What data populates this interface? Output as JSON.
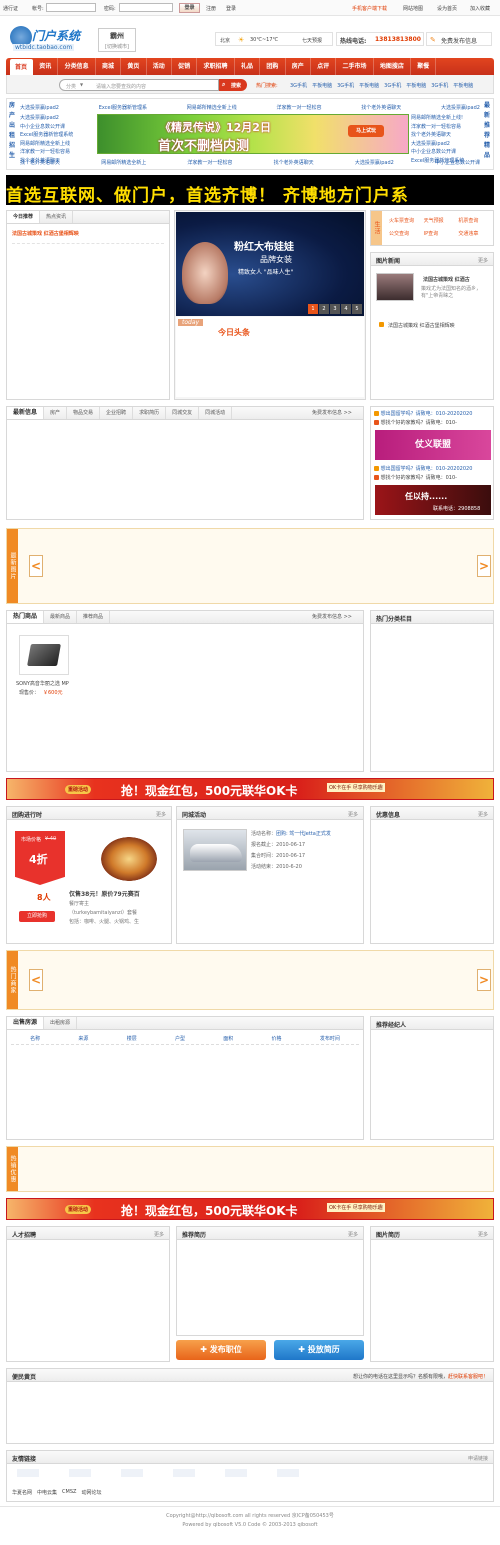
{
  "topbar": {
    "passport": "通行证",
    "account": "帐号:",
    "password": "密码:",
    "login_btn": "登录",
    "register": "注册",
    "login": "登录",
    "mobile": "手机客户端下载",
    "sitemap": "网站地图",
    "home": "设为首页",
    "fav": "加入收藏"
  },
  "header": {
    "logo_text": "门户系统",
    "logo_sub": "wtbidc.taobao.com",
    "city": "霸州",
    "city_switch": "[切换城市]",
    "weather_city": "北京",
    "weather_temp": "30℃~17℃",
    "weather_link": "七天预报",
    "hotline_label": "热线电话:",
    "hotline": "13813813800",
    "publish": "免费发布信息"
  },
  "nav": {
    "items": [
      "首页",
      "资讯",
      "分类信息",
      "商城",
      "黄页",
      "活动",
      "促销",
      "求职招聘",
      "礼品",
      "团购",
      "房产",
      "点评",
      "二手市场",
      "地图搜店",
      "聚餐"
    ],
    "search_type": "分类",
    "search_placeholder": "请输入您要查找的内容",
    "search_btn": "搜索",
    "hot_label": "热门搜索:",
    "hot": [
      "3G手机",
      "平板电脑",
      "3G手机",
      "平板电脑",
      "3G手机",
      "平板电脑",
      "3G手机",
      "平板电脑"
    ]
  },
  "adzone": {
    "left_labels": [
      "房",
      "产",
      "出",
      "租",
      "招",
      "生"
    ],
    "right_labels": [
      "最",
      "新",
      "推",
      "荐",
      "精",
      "品"
    ],
    "row_links": [
      "大选投票赢ipad2",
      "Excel服务器新管理系",
      "网易邮所精选全新上线",
      "洋家教一对一轻松容",
      "找个老外英语聊天",
      "大选投票赢ipad2"
    ],
    "col_left": [
      "大选投票赢ipad2",
      "中小企业息数公开课",
      "Excel服务器新管理系统",
      "网易邮所精选全新上线",
      "洋家教一对一轻松容易",
      "找个老外英语聊天"
    ],
    "col_right": [
      "网易邮所精选全新上线!",
      "洋家教一对一轻松容易",
      "找个老外英语聊天",
      "大选投票赢ipad2",
      "中小企业息数公开课",
      "Excel服务器新管理系统"
    ],
    "bottom_links": [
      "找个老外英语聊天",
      "网易邮所精选全新上",
      "洋家教一对一轻松容",
      "找个老外英语聊天",
      "大选投票赢ipad2",
      "中小企业息数公开课"
    ],
    "center_title": "《精灵传说》12月2日",
    "center_sub": "首次不删档内测",
    "center_btn": "马上试玩"
  },
  "marquee": {
    "text": "首选互联网、做门户，首选齐博！  齐博地方门户系"
  },
  "news": {
    "tab1": "今日推荐",
    "tab2": "热点资讯",
    "headline": "法国古城策戏  红酒古堡相辉映"
  },
  "focus": {
    "title": "粉红大布娃娃",
    "sub1": "品牌女装",
    "sub2": "精致女人 \"品味人生\"",
    "today": "today",
    "today_cn": "今日头条",
    "pages": [
      "1",
      "2",
      "3",
      "4",
      "5"
    ]
  },
  "services": {
    "label": "生活",
    "items": [
      "火车票查询",
      "天气预报",
      "机票查询",
      "公交查询",
      "IP查询",
      "交通违章"
    ]
  },
  "photo_news": {
    "title": "图片新闻",
    "more": "更多",
    "caption": "法国古城策戏 红酒古",
    "desc": "策戏尤为法国知名的酒乡，有\"上帝青睐之",
    "headline": "法国古城策戏 红酒古堡相辉映"
  },
  "latest": {
    "title": "最新信息",
    "tabs": [
      "房产",
      "物品交易",
      "企业招聘",
      "求职简历",
      "同城交友",
      "同城活动"
    ],
    "publish": "免费发布信息 >>"
  },
  "promo": {
    "line1": "想出国留学吗？请致电：010-20202020",
    "line2": "想找个好的家教吗？请致电：010-",
    "ad1": "仗义联盟",
    "ad2": "任以持......",
    "ad2_phone": "联系电话：2908858"
  },
  "pics": {
    "label": "最新图片",
    "prev": "<",
    "next": ">"
  },
  "products": {
    "title": "热门商品",
    "tabs": [
      "最新商品",
      "推荐商品"
    ],
    "publish": "免费发布信息 >>",
    "name": "SONY高音华丽之选 MP",
    "price_label": "现售价：",
    "price": "￥600元",
    "side_title": "热门分类栏目"
  },
  "banner": {
    "tag": "重磅活动",
    "text": "抢！现金红包，500元联华OK卡",
    "note": "OK卡在手 尽享购物乐趣"
  },
  "group": {
    "title": "团购进行时",
    "more": "更多",
    "price_label": "市场价格",
    "old_price": "¥ 40",
    "discount": "4折",
    "count": "8人",
    "buy_btn": "立即抢购",
    "deal": "仅售38元！原价79元赛百",
    "shop": "餐厅寄主",
    "shop_en": "（turkeybamitaiyanzi）套餐",
    "items": "包括：咖啡、火腿、火锅鸡、生"
  },
  "activity": {
    "title": "同城活动",
    "more": "更多",
    "name_label": "活动名称：",
    "name": "团购: 驾一代Jetta正式发",
    "signup_label": "报名截止：",
    "signup": "2010-06-17",
    "start_label": "集合时间：",
    "start": "2010-06-17",
    "end_label": "活动结束：",
    "end": "2010-6-20"
  },
  "offers": {
    "title": "优惠信息",
    "more": "更多"
  },
  "shops": {
    "label": "热门商家",
    "prev": "<",
    "next": ">"
  },
  "houses": {
    "title": "出售房源",
    "tab2": "出租房源",
    "cols": [
      "名称",
      "来源",
      "楼层",
      "户型",
      "面积",
      "价格",
      "发布时间"
    ],
    "side_title": "推荐经纪人"
  },
  "coupons": {
    "label": "热销优惠"
  },
  "jobs": {
    "title": "人才招聘",
    "more": "更多",
    "resume_title": "推荐简历",
    "photo_resume": "图片简历",
    "post_job": "发布职位",
    "post_resume": "投放简历"
  },
  "yellow": {
    "title": "便民黄页",
    "note": "想让你的电话在这里显示吗？名额有限哦，",
    "contact": "赶快联系客服吧！"
  },
  "friends": {
    "title": "友情链接",
    "apply": "申请链接",
    "links": [
      "华夏名网",
      "中电云集",
      "CMSZ",
      "动网论坛"
    ]
  },
  "footer": {
    "copyright": "Copyright@http://qibosoft.com all rights reserved 京ICP备050453号",
    "powered": "Powered by qibosoft V5.0 Code © 2003-2013 qibosoft"
  },
  "colors": {
    "accent": "#e8541a",
    "nav_red": "#d9381e",
    "link": "#2a62ad",
    "orange": "#f08a24"
  }
}
